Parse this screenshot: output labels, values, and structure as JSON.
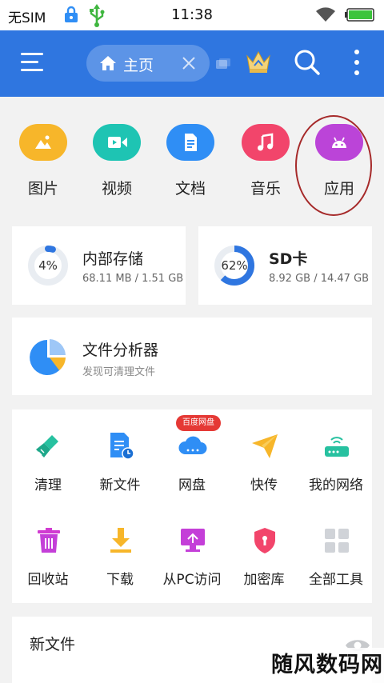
{
  "status_bar": {
    "carrier": "无SIM",
    "time": "11:38"
  },
  "header": {
    "home_label": "主页",
    "icons": [
      "menu-icon",
      "home-icon",
      "close-icon",
      "tabs-icon",
      "crown-icon",
      "search-icon",
      "more-icon"
    ]
  },
  "categories": [
    {
      "label": "图片",
      "icon": "image-icon",
      "color": "#f7b62a"
    },
    {
      "label": "视频",
      "icon": "video-icon",
      "color": "#1ec4b3"
    },
    {
      "label": "文档",
      "icon": "document-icon",
      "color": "#2f8ef5"
    },
    {
      "label": "音乐",
      "icon": "music-icon",
      "color": "#f2456b"
    },
    {
      "label": "应用",
      "icon": "android-icon",
      "color": "#bb44d8"
    }
  ],
  "storage": {
    "internal": {
      "pct": "4%",
      "title": "内部存储",
      "detail": "68.11 MB / 1.51 GB",
      "fraction": 0.04
    },
    "sd": {
      "pct": "62%",
      "title": "SD卡",
      "detail": "8.92 GB / 14.47 GB",
      "fraction": 0.62
    }
  },
  "analyzer": {
    "title": "文件分析器",
    "subtitle": "发现可清理文件"
  },
  "tools": {
    "badge": "百度网盘",
    "items": [
      {
        "label": "清理",
        "icon": "broom-icon"
      },
      {
        "label": "新文件",
        "icon": "new-file-icon"
      },
      {
        "label": "网盘",
        "icon": "cloud-icon"
      },
      {
        "label": "快传",
        "icon": "paper-plane-icon"
      },
      {
        "label": "我的网络",
        "icon": "router-icon"
      },
      {
        "label": "回收站",
        "icon": "trash-icon"
      },
      {
        "label": "下载",
        "icon": "download-icon"
      },
      {
        "label": "从PC访问",
        "icon": "pc-access-icon"
      },
      {
        "label": "加密库",
        "icon": "vault-icon"
      },
      {
        "label": "全部工具",
        "icon": "all-tools-icon"
      }
    ]
  },
  "new_files": {
    "title": "新文件"
  },
  "watermark": "随风数码网",
  "colors": {
    "accent": "#2f76e0",
    "background": "#f2f2f2"
  }
}
